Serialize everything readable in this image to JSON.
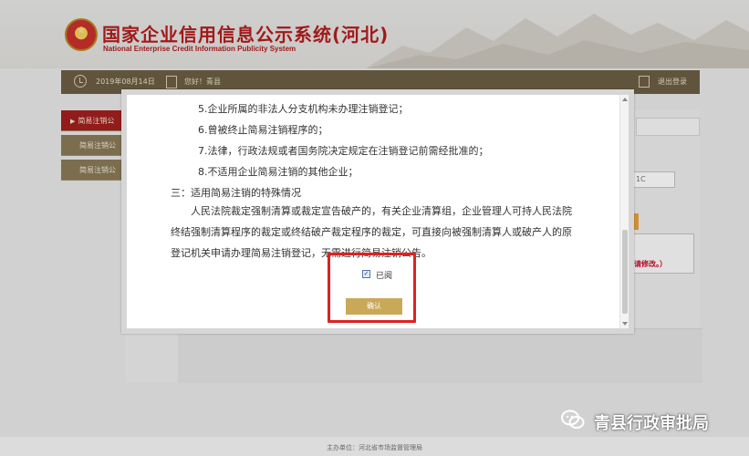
{
  "header": {
    "title": "国家企业信用信息公示系统(河北)",
    "subtitle": "National Enterprise Credit Information Publicity System"
  },
  "topbar": {
    "date": "2019年08月14日",
    "greeting": "您好！青县",
    "logout": "退出登录"
  },
  "sidebar": {
    "items": [
      {
        "label": "简易注销公",
        "active": true
      },
      {
        "label": "简易注销公",
        "active": false
      },
      {
        "label": "简易注销公",
        "active": false
      }
    ]
  },
  "background": {
    "field_value": "1C",
    "note": "请修改。）"
  },
  "modal": {
    "lines": [
      "5.企业所属的非法人分支机构未办理注销登记；",
      "6.曾被终止简易注销程序的；",
      "7.法律，行政法规或者国务院决定规定在注销登记前需经批准的；",
      "8.不适用企业简易注销的其他企业；",
      "三：适用简易注销的特殊情况"
    ],
    "paragraph": "人民法院裁定强制清算或裁定宣告破产的，有关企业清算组，企业管理人可持人民法院终结强制清算程序的裁定或终结破产裁定程序的裁定，可直接向被强制清算人或破产人的原登记机关申请办理简易注销登记，无需进行简易注销公告。",
    "checkbox": {
      "label": "已阅",
      "checked": true
    },
    "confirm_button": "确认"
  },
  "footer": {
    "text": "主办单位：河北省市场监督管理局"
  },
  "watermark": {
    "text": "青县行政审批局",
    "icon": "wechat-icon"
  },
  "colors": {
    "brand_red": "#b31e1e",
    "topbar": "#6b5e45",
    "sidebar": "#8a7a57",
    "sidebar_active": "#a31f1f",
    "button_gold": "#c9a958",
    "highlight": "#e0211f"
  }
}
